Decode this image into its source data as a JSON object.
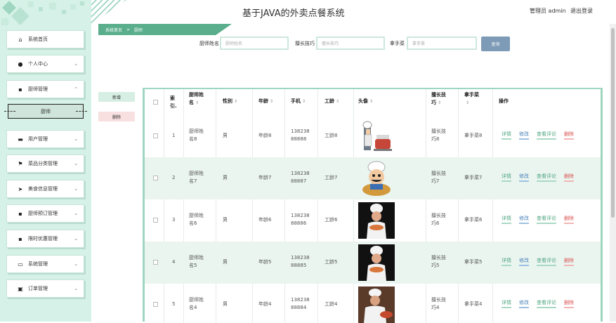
{
  "header": {
    "title": "基于JAVA的外卖点餐系统",
    "admin": "管理员 admin",
    "logout": "退出登录"
  },
  "breadcrumb": {
    "home": "系统首页",
    "sep": ">",
    "current": "厨师"
  },
  "sidebar": {
    "items": [
      {
        "label": "系统首页",
        "icon": "home-icon",
        "chevron": ""
      },
      {
        "label": "个人中心",
        "icon": "user-icon",
        "chevron": "⌄"
      },
      {
        "label": "厨师管理",
        "icon": "grid-icon",
        "chevron": "⌃"
      },
      {
        "label": "用户管理",
        "icon": "monitor-icon",
        "chevron": "⌄"
      },
      {
        "label": "菜品分类管理",
        "icon": "flag-icon",
        "chevron": "⌄"
      },
      {
        "label": "美食信息管理",
        "icon": "send-icon",
        "chevron": "⌄"
      },
      {
        "label": "厨师预订管理",
        "icon": "grid-icon",
        "chevron": "⌄"
      },
      {
        "label": "限时优惠管理",
        "icon": "grid-icon",
        "chevron": "⌄"
      },
      {
        "label": "系统管理",
        "icon": "keyboard-icon",
        "chevron": "⌄"
      },
      {
        "label": "订单管理",
        "icon": "bag-icon",
        "chevron": "⌄"
      }
    ],
    "sub_item": "厨师"
  },
  "filters": {
    "name_label": "厨师姓名",
    "name_placeholder": "厨师姓名",
    "skill_label": "擅长技巧",
    "skill_placeholder": "擅长技巧",
    "dish_label": "拿手菜",
    "dish_placeholder": "拿手菜",
    "search_button": "查询"
  },
  "buttons": {
    "add": "新增",
    "delete": "删除"
  },
  "table": {
    "headers": {
      "index_1": "索",
      "index_2": "引.",
      "name_1": "厨师姓",
      "name_2": "名",
      "gender": "性别",
      "age": "年龄",
      "phone": "手机",
      "seniority": "工龄",
      "avatar": "头像",
      "skill_1": "擅长技",
      "skill_2": "巧",
      "dish_1": "拿手菜",
      "dish_2": "",
      "actions": "操作",
      "sort": "⇕"
    },
    "rows": [
      {
        "index": "1",
        "name_1": "厨师姓",
        "name_2": "名8",
        "gender": "男",
        "age": "年龄8",
        "phone_1": "138238",
        "phone_2": "88888",
        "seniority": "工龄8",
        "skill_1": "擅长技",
        "skill_2": "巧8",
        "dish": "拿手菜8",
        "avatar": "chef-cooking-icon"
      },
      {
        "index": "2",
        "name_1": "厨师姓",
        "name_2": "名7",
        "gender": "男",
        "age": "年龄7",
        "phone_1": "138238",
        "phone_2": "88887",
        "seniority": "工龄7",
        "skill_1": "擅长技",
        "skill_2": "巧7",
        "dish": "拿手菜7",
        "avatar": "chef-cartoon-icon"
      },
      {
        "index": "3",
        "name_1": "厨师姓",
        "name_2": "名6",
        "gender": "男",
        "age": "年龄6",
        "phone_1": "138238",
        "phone_2": "88886",
        "seniority": "工龄6",
        "skill_1": "擅长技",
        "skill_2": "巧6",
        "dish": "拿手菜6",
        "avatar": "chef-photo-icon"
      },
      {
        "index": "4",
        "name_1": "厨师姓",
        "name_2": "名5",
        "gender": "男",
        "age": "年龄5",
        "phone_1": "138238",
        "phone_2": "88885",
        "seniority": "工龄5",
        "skill_1": "擅长技",
        "skill_2": "巧5",
        "dish": "拿手菜5",
        "avatar": "chef-photo-icon"
      },
      {
        "index": "5",
        "name_1": "厨师姓",
        "name_2": "名4",
        "gender": "男",
        "age": "年龄4",
        "phone_1": "138238",
        "phone_2": "88884",
        "seniority": "工龄4",
        "skill_1": "擅长技",
        "skill_2": "巧4",
        "dish": "拿手菜4",
        "avatar": "chef-kitchen-icon"
      }
    ],
    "actions": {
      "detail": "详情",
      "edit": "修改",
      "review": "查看评论",
      "remove": "删除"
    }
  },
  "colors": {
    "sidebar_bg": "#d6f1e7",
    "accent": "#5aae8c",
    "search_btn": "#7d9ab6",
    "row_alt": "#eaf5f0"
  }
}
